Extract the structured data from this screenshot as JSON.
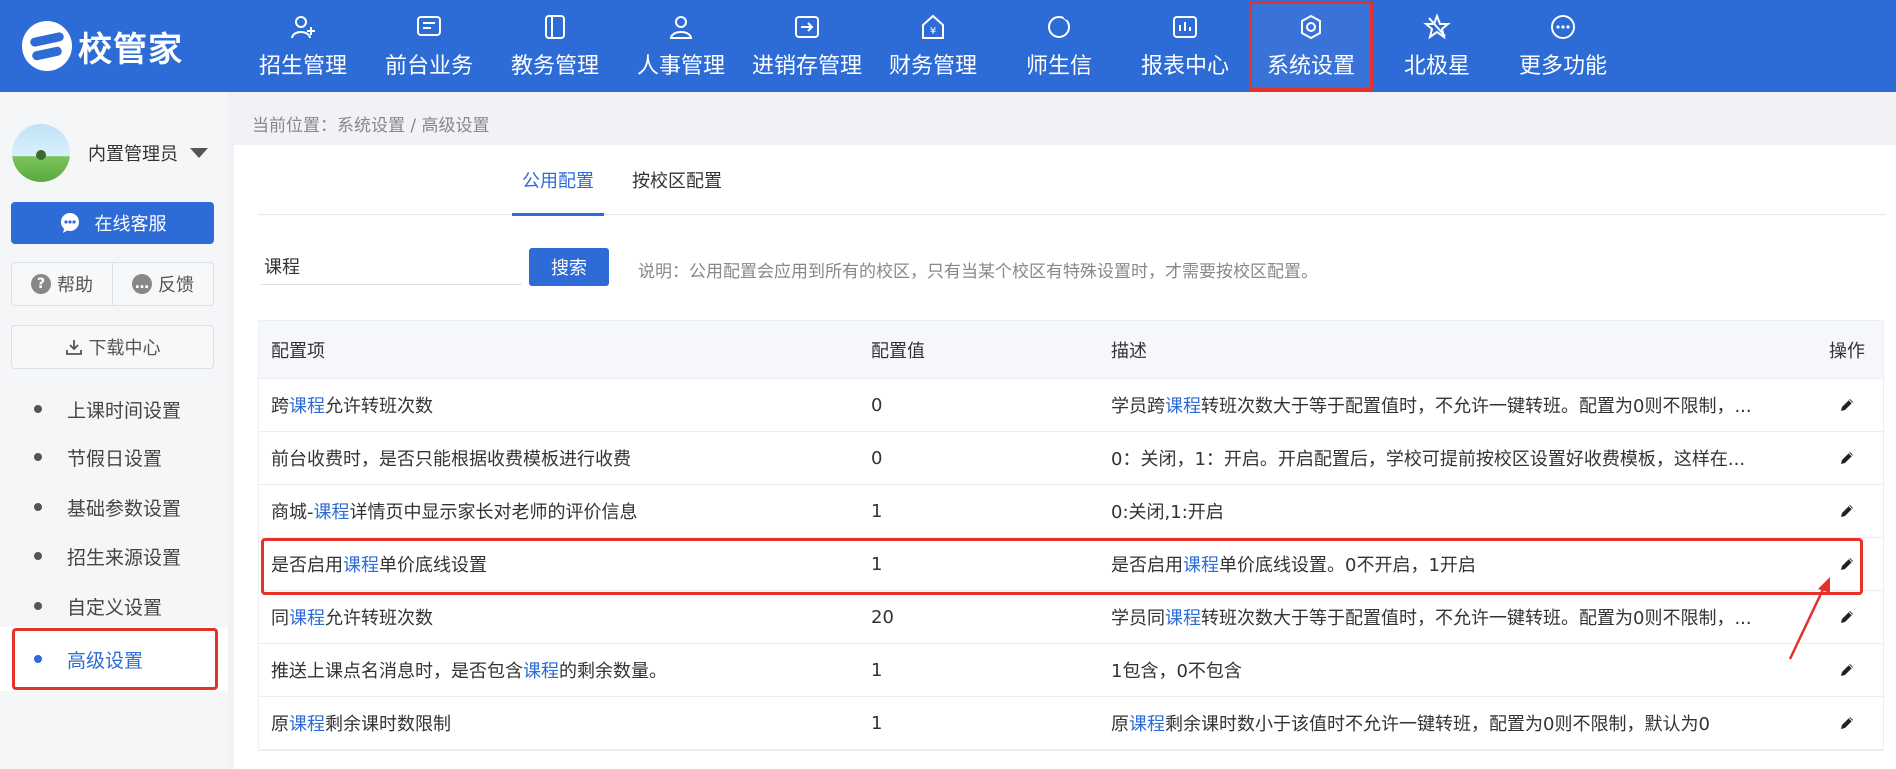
{
  "app": {
    "logo_text": "校管家"
  },
  "nav": [
    {
      "label": "招生管理",
      "icon": "user-add-icon"
    },
    {
      "label": "前台业务",
      "icon": "desk-icon"
    },
    {
      "label": "教务管理",
      "icon": "book-icon"
    },
    {
      "label": "人事管理",
      "icon": "person-icon"
    },
    {
      "label": "进销存管理",
      "icon": "inventory-icon"
    },
    {
      "label": "财务管理",
      "icon": "yen-house-icon"
    },
    {
      "label": "师生信",
      "icon": "chat-icon"
    },
    {
      "label": "报表中心",
      "icon": "report-icon"
    },
    {
      "label": "系统设置",
      "icon": "settings-icon",
      "active": true
    },
    {
      "label": "北极星",
      "icon": "star-icon"
    },
    {
      "label": "更多功能",
      "icon": "more-icon"
    }
  ],
  "sidebar": {
    "user_name": "内置管理员",
    "service_btn": "在线客服",
    "help": "帮助",
    "feedback": "反馈",
    "download": "下载中心",
    "menu": [
      "上课时间设置",
      "节假日设置",
      "基础参数设置",
      "招生来源设置",
      "自定义设置",
      "高级设置"
    ],
    "active_menu": "高级设置"
  },
  "breadcrumb": "当前位置：系统设置 / 高级设置",
  "tabs": [
    "公用配置",
    "按校区配置"
  ],
  "search": {
    "value": "课程",
    "button": "搜索"
  },
  "note": "说明：公用配置会应用到所有的校区，只有当某个校区有特殊设置时，才需要按校区配置。",
  "table": {
    "headers": [
      "配置项",
      "配置值",
      "描述",
      "操作"
    ],
    "rows": [
      {
        "item": [
          "跨",
          "课程",
          "允许转班次数"
        ],
        "value": "0",
        "desc": [
          "学员跨",
          "课程",
          "转班次数大于等于配置值时，不允许一键转班。配置为0则不限制，..."
        ]
      },
      {
        "item": [
          "前台收费时，是否只能根据收费模板进行收费",
          "",
          ""
        ],
        "value": "0",
        "desc": [
          "0：关闭，1：开启。开启配置后，学校可提前按校区设置好收费模板，这样在...",
          "",
          ""
        ]
      },
      {
        "item": [
          "商城-",
          "课程",
          "详情页中显示家长对老师的评价信息"
        ],
        "value": "1",
        "desc": [
          "0:关闭,1:开启",
          "",
          ""
        ]
      },
      {
        "item": [
          "是否启用",
          "课程",
          "单价底线设置"
        ],
        "value": "1",
        "desc": [
          "是否启用",
          "课程",
          "单价底线设置。0不开启，1开启"
        ],
        "highlighted": true
      },
      {
        "item": [
          "同",
          "课程",
          "允许转班次数"
        ],
        "value": "20",
        "desc": [
          "学员同",
          "课程",
          "转班次数大于等于配置值时，不允许一键转班。配置为0则不限制，..."
        ]
      },
      {
        "item": [
          "推送上课点名消息时，是否包含",
          "课程",
          "的剩余数量。"
        ],
        "value": "1",
        "desc": [
          "1包含，0不包含",
          "",
          ""
        ]
      },
      {
        "item": [
          "原",
          "课程",
          "剩余课时数限制"
        ],
        "value": "1",
        "desc": [
          "原",
          "课程",
          "剩余课时数小于该值时不允许一键转班，配置为0则不限制，默认为0"
        ]
      }
    ]
  },
  "colors": {
    "primary": "#2d6bd6",
    "annotation": "#e5312b"
  }
}
